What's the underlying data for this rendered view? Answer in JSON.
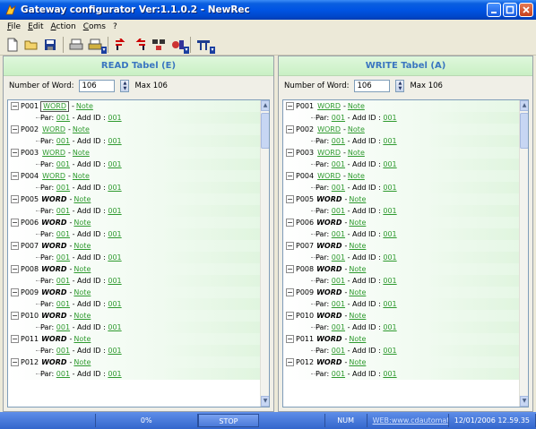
{
  "window": {
    "title": "Gateway configurator Ver:1.1.0.2 - NewRec"
  },
  "menu": {
    "items": [
      "File",
      "Edit",
      "Action",
      "Coms",
      "?"
    ]
  },
  "toolbar": {
    "icons": [
      "new-file-icon",
      "open-folder-icon",
      "save-icon",
      "print-icon",
      "print-setup-icon",
      "upload-icon",
      "download-icon",
      "network-icon",
      "settings-icon",
      "display-icon"
    ]
  },
  "left_panel": {
    "title": "READ Tabel (E)",
    "number_label": "Number of Word:",
    "number_value": "106",
    "max_label": "Max 106"
  },
  "right_panel": {
    "title": "WRITE Tabel (A)",
    "number_label": "Number of Word:",
    "number_value": "106",
    "max_label": "Max 106"
  },
  "tree": {
    "par_label": "Par:",
    "addid_label": "- Add ID :",
    "dash": "-",
    "note": "Note",
    "par_value": "001",
    "addid_value": "001",
    "items": [
      {
        "name": "P001",
        "word": "WORD",
        "style": "boxed"
      },
      {
        "name": "P002",
        "word": "WORD",
        "style": "link"
      },
      {
        "name": "P003",
        "word": "WORD",
        "style": "link"
      },
      {
        "name": "P004",
        "word": "WORD",
        "style": "link"
      },
      {
        "name": "P005",
        "word": "WORD",
        "style": "bold"
      },
      {
        "name": "P006",
        "word": "WORD",
        "style": "bold"
      },
      {
        "name": "P007",
        "word": "WORD",
        "style": "bold"
      },
      {
        "name": "P008",
        "word": "WORD",
        "style": "bold"
      },
      {
        "name": "P009",
        "word": "WORD",
        "style": "bold"
      },
      {
        "name": "P010",
        "word": "WORD",
        "style": "bold"
      },
      {
        "name": "P011",
        "word": "WORD",
        "style": "bold"
      },
      {
        "name": "P012",
        "word": "WORD",
        "style": "bold"
      }
    ],
    "right_first_style": "link"
  },
  "statusbar": {
    "progress": "0%",
    "stop": "STOP",
    "num": "NUM",
    "web": "WEB:www.cdautomation.com",
    "datetime": "12/01/2006 12.59.35"
  },
  "colors": {
    "title_blue": "#0054e3",
    "panel_title": "#3a76c0",
    "link_green": "#2e9a2e",
    "header_green": "#c9f0c4"
  }
}
